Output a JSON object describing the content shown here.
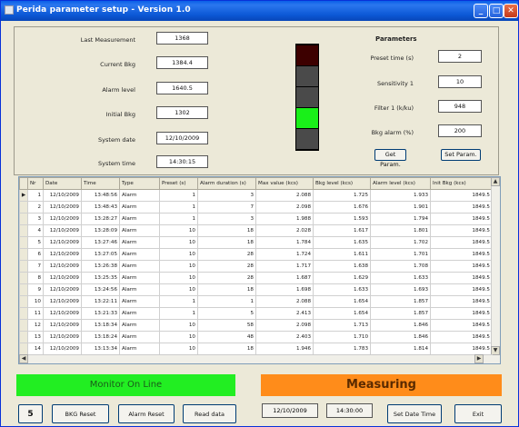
{
  "window": {
    "title": "Perida parameter setup - Version 1.0"
  },
  "left_fields": [
    {
      "label": "Last Measurement",
      "value": "1368"
    },
    {
      "label": "Current Bkg",
      "value": "1384.4"
    },
    {
      "label": "Alarm level",
      "value": "1640.5"
    },
    {
      "label": "Initial Bkg",
      "value": "1302"
    },
    {
      "label": "System date",
      "value": "12/10/2009"
    },
    {
      "label": "System time",
      "value": "14:30:15"
    }
  ],
  "lights": {
    "colors": [
      "#3d0000",
      "#4a4a4a",
      "#4a4a4a",
      "#19f019",
      "#4a4a4a"
    ]
  },
  "parameters": {
    "title": "Parameters",
    "fields": [
      {
        "label": "Preset time (s)",
        "value": "2"
      },
      {
        "label": "Sensitivity 1",
        "value": "10"
      },
      {
        "label": "Filter 1 (k/ku)",
        "value": "948"
      },
      {
        "label": "Bkg alarm (%)",
        "value": "200"
      }
    ],
    "get_params_label": "Get Param.",
    "set_params_label": "Set Param."
  },
  "table": {
    "columns": [
      "Nr",
      "Date",
      "Time",
      "Type",
      "Preset (s)",
      "Alarm duration (s)",
      "Max value (kcs)",
      "Bkg level (kcs)",
      "Alarm level (kcs)",
      "Init Bkg (kcs)"
    ],
    "rows": [
      [
        "1",
        "12/10/2009",
        "13:48:56",
        "Alarm",
        "1",
        "3",
        "2.088",
        "1.725",
        "1.933",
        "1849.5"
      ],
      [
        "2",
        "12/10/2009",
        "13:48:43",
        "Alarm",
        "1",
        "7",
        "2.098",
        "1.676",
        "1.901",
        "1849.5"
      ],
      [
        "3",
        "12/10/2009",
        "13:28:27",
        "Alarm",
        "1",
        "3",
        "1.988",
        "1.593",
        "1.794",
        "1849.5"
      ],
      [
        "4",
        "12/10/2009",
        "13:28:09",
        "Alarm",
        "10",
        "18",
        "2.028",
        "1.617",
        "1.801",
        "1849.5"
      ],
      [
        "5",
        "12/10/2009",
        "13:27:46",
        "Alarm",
        "10",
        "18",
        "1.784",
        "1.635",
        "1.702",
        "1849.5"
      ],
      [
        "6",
        "12/10/2009",
        "13:27:05",
        "Alarm",
        "10",
        "28",
        "1.724",
        "1.611",
        "1.701",
        "1849.5"
      ],
      [
        "7",
        "12/10/2009",
        "13:26:38",
        "Alarm",
        "10",
        "28",
        "1.717",
        "1.638",
        "1.708",
        "1849.5"
      ],
      [
        "8",
        "12/10/2009",
        "13:25:35",
        "Alarm",
        "10",
        "28",
        "1.687",
        "1.629",
        "1.633",
        "1849.5"
      ],
      [
        "9",
        "12/10/2009",
        "13:24:56",
        "Alarm",
        "10",
        "18",
        "1.698",
        "1.633",
        "1.693",
        "1849.5"
      ],
      [
        "10",
        "12/10/2009",
        "13:22:11",
        "Alarm",
        "1",
        "1",
        "2.088",
        "1.654",
        "1.857",
        "1849.5"
      ],
      [
        "11",
        "12/10/2009",
        "13:21:33",
        "Alarm",
        "1",
        "5",
        "2.413",
        "1.654",
        "1.857",
        "1849.5"
      ],
      [
        "12",
        "12/10/2009",
        "13:18:34",
        "Alarm",
        "10",
        "58",
        "2.098",
        "1.713",
        "1.846",
        "1849.5"
      ],
      [
        "13",
        "12/10/2009",
        "13:18:24",
        "Alarm",
        "10",
        "48",
        "2.403",
        "1.710",
        "1.846",
        "1849.5"
      ],
      [
        "14",
        "12/10/2009",
        "13:13:34",
        "Alarm",
        "10",
        "18",
        "1.946",
        "1.783",
        "1.814",
        "1849.5"
      ]
    ]
  },
  "status": {
    "monitor": {
      "text": "Monitor On Line",
      "color": "#22ee22"
    },
    "measuring": {
      "text": "Measuring",
      "color": "#ff8c1a"
    }
  },
  "bottom": {
    "counter": "5",
    "bkg_reset": "BKG Reset",
    "alarm_reset": "Alarm Reset",
    "read_data": "Read data",
    "date": "12/10/2009",
    "time": "14:30:00",
    "set_datetime": "Set Date Time",
    "exit": "Exit"
  }
}
